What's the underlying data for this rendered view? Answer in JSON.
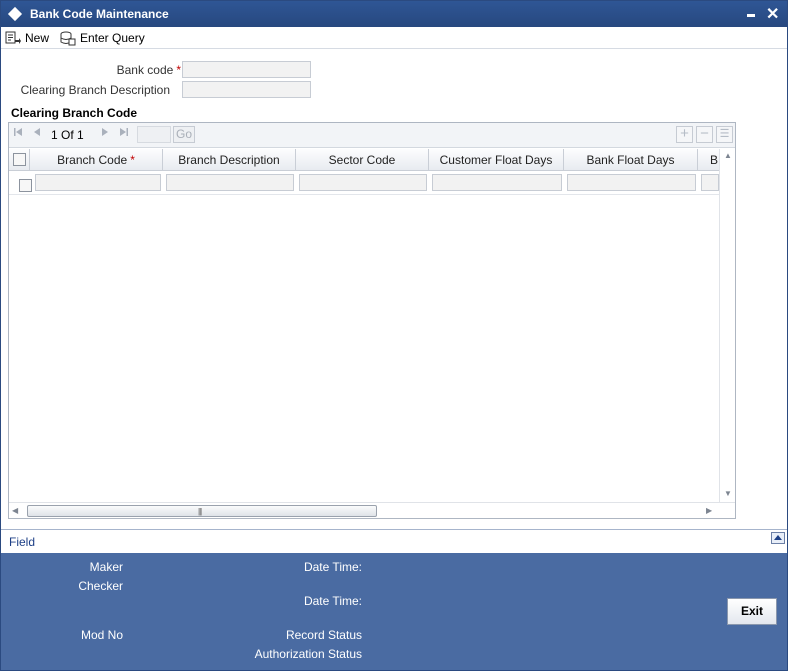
{
  "window": {
    "title": "Bank Code Maintenance",
    "minimize_glyph": "▬",
    "close_glyph": "✕"
  },
  "toolbar": {
    "new_label": "New",
    "enter_query_label": "Enter Query"
  },
  "form": {
    "bank_code_label": "Bank code",
    "required_mark": "*",
    "bank_code_value": "",
    "clearing_branch_desc_label": "Clearing Branch Description",
    "clearing_branch_desc_value": ""
  },
  "grid": {
    "section_title": "Clearing Branch Code",
    "pager": {
      "current": "1",
      "of_label": "Of",
      "total": "1",
      "go_label": "Go",
      "page_input_value": ""
    },
    "columns": [
      {
        "label": "Branch Code",
        "required": "*"
      },
      {
        "label": "Branch Description"
      },
      {
        "label": "Sector Code"
      },
      {
        "label": "Customer Float Days"
      },
      {
        "label": "Bank Float Days"
      },
      {
        "label": "B"
      }
    ],
    "rows": [
      {
        "branch_code": "",
        "branch_description": "",
        "sector_code": "",
        "customer_float_days": "",
        "bank_float_days": ""
      }
    ],
    "scroll_grip": "|||"
  },
  "field_bar": {
    "label": "Field"
  },
  "footer": {
    "maker_label": "Maker",
    "checker_label": "Checker",
    "date_time_label_1": "Date Time:",
    "date_time_label_2": "Date Time:",
    "mod_no_label": "Mod No",
    "record_status_label": "Record Status",
    "authorization_status_label": "Authorization Status",
    "exit_label": "Exit"
  },
  "colors": {
    "titlebar": "#2b4f8c",
    "footer": "#4a6ba2",
    "required": "#c00000",
    "field_link": "#1d3f86"
  }
}
